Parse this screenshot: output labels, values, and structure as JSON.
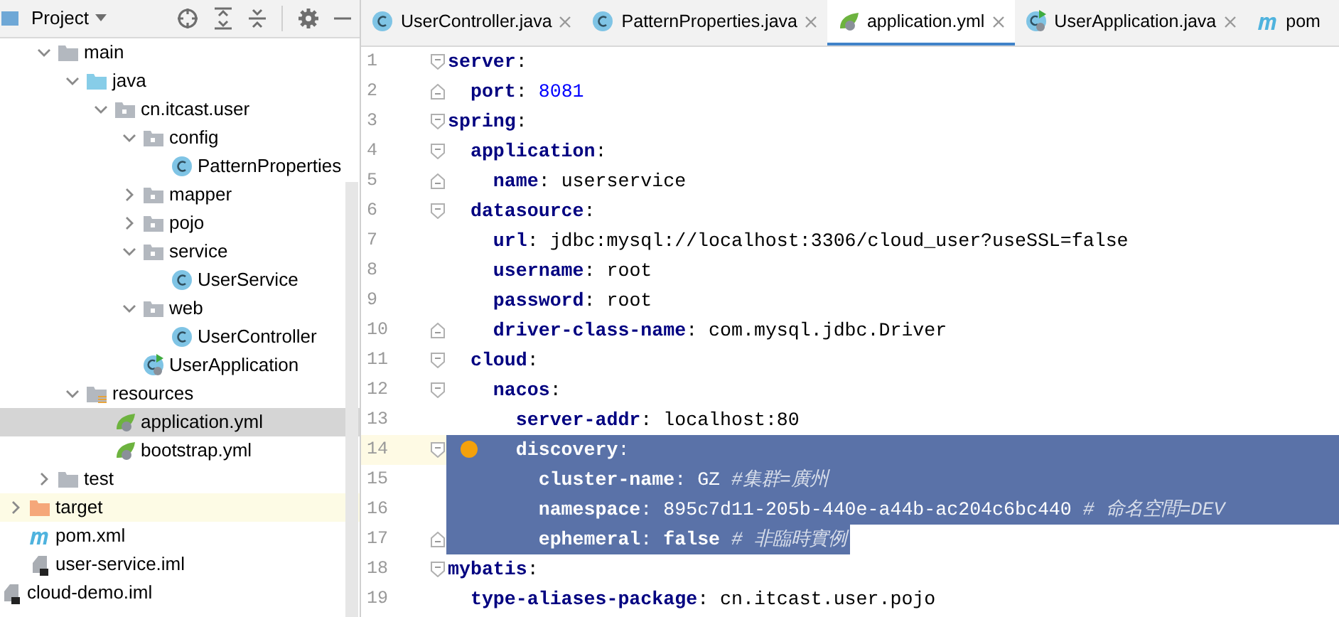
{
  "project_panel": {
    "title": "Project",
    "tree": [
      {
        "children": [
          {
            "children": [
              {
                "label": "main",
                "kind": "folder-plain",
                "expanded": true,
                "selected": false,
                "children": [
                  {
                    "label": "java",
                    "kind": "folder-source",
                    "expanded": true,
                    "selected": false,
                    "children": [
                      {
                        "label": "cn.itcast.user",
                        "kind": "package",
                        "expanded": true,
                        "selected": false,
                        "children": [
                          {
                            "label": "config",
                            "kind": "package",
                            "expanded": true,
                            "selected": false,
                            "children": [
                              {
                                "label": "PatternProperties",
                                "kind": "class",
                                "selected": false
                              }
                            ]
                          },
                          {
                            "label": "mapper",
                            "kind": "package",
                            "expanded": false,
                            "selected": false
                          },
                          {
                            "label": "pojo",
                            "kind": "package",
                            "expanded": false,
                            "selected": false
                          },
                          {
                            "label": "service",
                            "kind": "package",
                            "expanded": true,
                            "selected": false,
                            "children": [
                              {
                                "label": "UserService",
                                "kind": "class",
                                "selected": false
                              }
                            ]
                          },
                          {
                            "label": "web",
                            "kind": "package",
                            "expanded": true,
                            "selected": false,
                            "children": [
                              {
                                "label": "UserController",
                                "kind": "class",
                                "selected": false
                              }
                            ]
                          },
                          {
                            "label": "UserApplication",
                            "kind": "app",
                            "selected": false
                          }
                        ]
                      }
                    ]
                  },
                  {
                    "label": "resources",
                    "kind": "folder-resources",
                    "expanded": true,
                    "selected": false,
                    "children": [
                      {
                        "label": "application.yml",
                        "kind": "spring",
                        "selected": true
                      },
                      {
                        "label": "bootstrap.yml",
                        "kind": "spring",
                        "selected": false
                      }
                    ]
                  }
                ]
              },
              {
                "label": "test",
                "kind": "folder-plain",
                "expanded": false,
                "selected": false
              }
            ]
          },
          {
            "label": "target",
            "kind": "folder-excluded",
            "expanded": false,
            "selected": false
          },
          {
            "label": "pom.xml",
            "kind": "maven",
            "selected": false
          },
          {
            "label": "user-service.iml",
            "kind": "iml",
            "selected": false
          }
        ]
      },
      {
        "label": "cloud-demo.iml",
        "kind": "iml",
        "selected": false
      }
    ]
  },
  "tabs": [
    {
      "label": "UserController.java",
      "kind": "class",
      "selected": false
    },
    {
      "label": "PatternProperties.java",
      "kind": "class",
      "selected": false
    },
    {
      "label": "application.yml",
      "kind": "spring",
      "selected": true
    },
    {
      "label": "UserApplication.java",
      "kind": "app",
      "selected": false
    },
    {
      "label": "pom",
      "kind": "maven",
      "selected": false
    }
  ],
  "editor": {
    "lines": [
      {
        "number": "1",
        "fold_start": true,
        "selected": false,
        "tokens": [
          {
            "kind": "key",
            "text": "server"
          },
          {
            "kind": "punct",
            "text": ":"
          }
        ]
      },
      {
        "number": "2",
        "fold_end": true,
        "selected": false,
        "tokens": [
          {
            "kind": "key",
            "text": "  port"
          },
          {
            "kind": "punct",
            "text": ": "
          },
          {
            "kind": "num",
            "text": "8081"
          }
        ]
      },
      {
        "number": "3",
        "fold_start": true,
        "selected": false,
        "tokens": [
          {
            "kind": "key",
            "text": "spring"
          },
          {
            "kind": "punct",
            "text": ":"
          }
        ]
      },
      {
        "number": "4",
        "fold_start": true,
        "selected": false,
        "tokens": [
          {
            "kind": "key",
            "text": "  application"
          },
          {
            "kind": "punct",
            "text": ":"
          }
        ]
      },
      {
        "number": "5",
        "fold_end": true,
        "selected": false,
        "tokens": [
          {
            "kind": "key",
            "text": "    name"
          },
          {
            "kind": "punct",
            "text": ": "
          },
          {
            "kind": "str",
            "text": "userservice"
          }
        ]
      },
      {
        "number": "6",
        "fold_start": true,
        "selected": false,
        "tokens": [
          {
            "kind": "key",
            "text": "  datasource"
          },
          {
            "kind": "punct",
            "text": ":"
          }
        ]
      },
      {
        "number": "7",
        "selected": false,
        "tokens": [
          {
            "kind": "key",
            "text": "    url"
          },
          {
            "kind": "punct",
            "text": ": "
          },
          {
            "kind": "str",
            "text": "jdbc:mysql://localhost:3306/cloud_user?useSSL=false"
          }
        ]
      },
      {
        "number": "8",
        "selected": false,
        "tokens": [
          {
            "kind": "key",
            "text": "    username"
          },
          {
            "kind": "punct",
            "text": ": "
          },
          {
            "kind": "str",
            "text": "root"
          }
        ]
      },
      {
        "number": "9",
        "selected": false,
        "tokens": [
          {
            "kind": "key",
            "text": "    password"
          },
          {
            "kind": "punct",
            "text": ": "
          },
          {
            "kind": "str",
            "text": "root"
          }
        ]
      },
      {
        "number": "10",
        "fold_end": true,
        "selected": false,
        "tokens": [
          {
            "kind": "key",
            "text": "    driver-class-name"
          },
          {
            "kind": "punct",
            "text": ": "
          },
          {
            "kind": "str",
            "text": "com.mysql.jdbc.Driver"
          }
        ]
      },
      {
        "number": "11",
        "fold_start": true,
        "selected": false,
        "tokens": [
          {
            "kind": "key",
            "text": "  cloud"
          },
          {
            "kind": "punct",
            "text": ":"
          }
        ]
      },
      {
        "number": "12",
        "fold_start": true,
        "selected": false,
        "tokens": [
          {
            "kind": "key",
            "text": "    nacos"
          },
          {
            "kind": "punct",
            "text": ":"
          }
        ]
      },
      {
        "number": "13",
        "selected": false,
        "tokens": [
          {
            "kind": "key",
            "text": "      server-addr"
          },
          {
            "kind": "punct",
            "text": ": "
          },
          {
            "kind": "str",
            "text": "localhost:80"
          }
        ]
      },
      {
        "number": "14",
        "fold_start": true,
        "selected": true,
        "caret": true,
        "bulb": true,
        "tokens": [
          {
            "kind": "key",
            "text": "      discovery"
          },
          {
            "kind": "punct",
            "text": ":"
          }
        ]
      },
      {
        "number": "15",
        "selected": true,
        "tokens": [
          {
            "kind": "key",
            "text": "        cluster-name"
          },
          {
            "kind": "punct",
            "text": ": "
          },
          {
            "kind": "str",
            "text": "GZ"
          },
          {
            "kind": "comment",
            "text": "#集群=廣州"
          }
        ]
      },
      {
        "number": "16",
        "selected": true,
        "tokens": [
          {
            "kind": "key",
            "text": "        namespace"
          },
          {
            "kind": "punct",
            "text": ": "
          },
          {
            "kind": "str",
            "text": "895c7d11-205b-440e-a44b-ac204c6bc440"
          },
          {
            "kind": "comment",
            "text": "# 命名空間=DEV"
          }
        ]
      },
      {
        "number": "17",
        "fold_end": true,
        "selected": true,
        "tokens": [
          {
            "kind": "key",
            "text": "        ephemeral"
          },
          {
            "kind": "punct",
            "text": ": "
          },
          {
            "kind": "bool",
            "text": "false"
          },
          {
            "kind": "comment",
            "text": "# 非臨時實例"
          }
        ]
      },
      {
        "number": "18",
        "fold_start": true,
        "selected": false,
        "tokens": [
          {
            "kind": "key",
            "text": "mybatis"
          },
          {
            "kind": "punct",
            "text": ":"
          }
        ]
      },
      {
        "number": "19",
        "selected": false,
        "tokens": [
          {
            "kind": "key",
            "text": "  type-aliases-package"
          },
          {
            "kind": "punct",
            "text": ": "
          },
          {
            "kind": "str",
            "text": "cn.itcast.user.pojo"
          }
        ]
      }
    ]
  }
}
